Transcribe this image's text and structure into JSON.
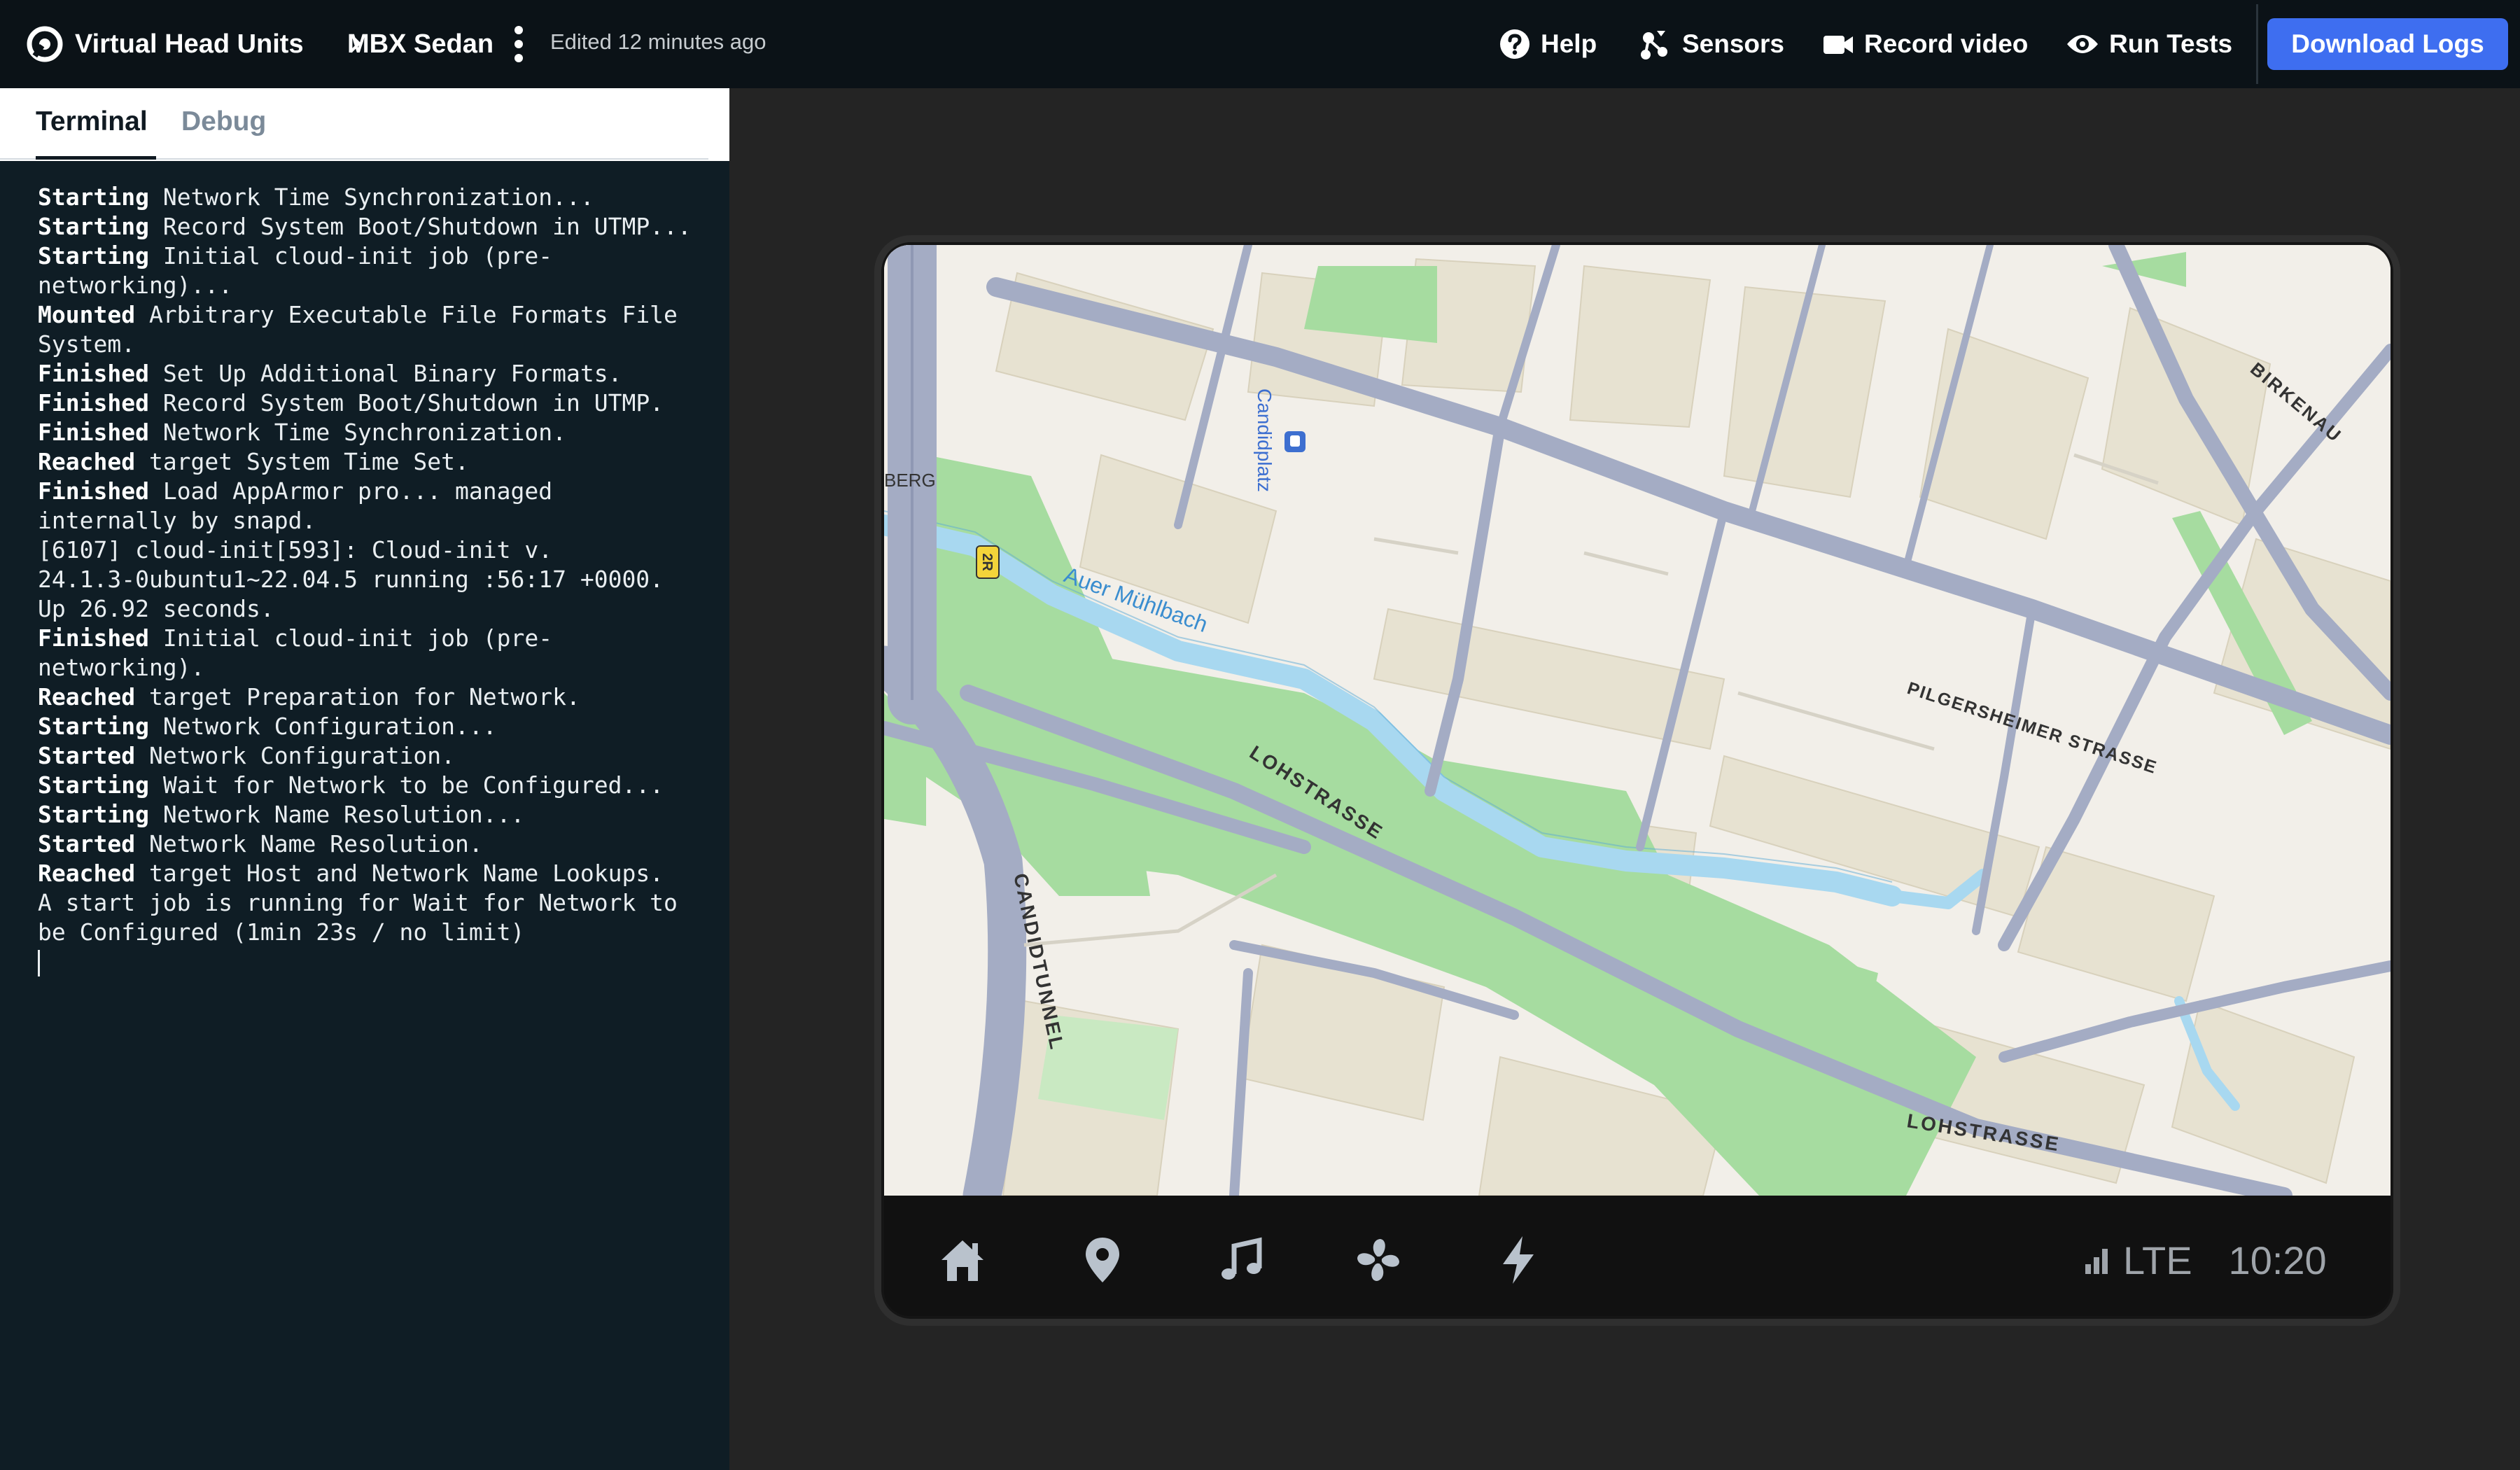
{
  "header": {
    "breadcrumb": [
      "Virtual Head Units",
      "MBX Sedan"
    ],
    "edited_text": "Edited 12 minutes ago",
    "actions": [
      {
        "label": "Help",
        "icon": "help-icon"
      },
      {
        "label": "Sensors",
        "icon": "sensors-icon"
      },
      {
        "label": "Record video",
        "icon": "video-camera-icon"
      },
      {
        "label": "Run Tests",
        "icon": "eye-icon"
      }
    ],
    "download_label": "Download Logs",
    "colors": {
      "topbar": "#0b1217",
      "accent": "#3e6ef0"
    }
  },
  "tabs": [
    {
      "label": "Terminal",
      "active": true
    },
    {
      "label": "Debug",
      "active": false
    }
  ],
  "terminal": {
    "lines": [
      {
        "status": "Starting",
        "text": " Network Time Synchronization..."
      },
      {
        "status": "Starting",
        "text": " Record System Boot/Shutdown in UTMP..."
      },
      {
        "status": "Starting",
        "text": " Initial cloud-init job (pre-"
      },
      {
        "status": "",
        "text": "networking)..."
      },
      {
        "status": "Mounted",
        "text": " Arbitrary Executable File Formats File"
      },
      {
        "status": "",
        "text": "System."
      },
      {
        "status": "Finished",
        "text": " Set Up Additional Binary Formats."
      },
      {
        "status": "Finished",
        "text": " Record System Boot/Shutdown in UTMP."
      },
      {
        "status": "Finished",
        "text": " Network Time Synchronization."
      },
      {
        "status": "Reached",
        "text": " target System Time Set."
      },
      {
        "status": "Finished",
        "text": " Load AppArmor pro... managed"
      },
      {
        "status": "",
        "text": "internally by snapd."
      },
      {
        "status": "",
        "text": "[6107] cloud-init[593]: Cloud-init v."
      },
      {
        "status": "",
        "text": "24.1.3-0ubuntu1~22.04.5 running :56:17 +0000."
      },
      {
        "status": "",
        "text": "Up 26.92 seconds."
      },
      {
        "status": "Finished",
        "text": " Initial cloud-init job (pre-"
      },
      {
        "status": "",
        "text": "networking)."
      },
      {
        "status": "Reached",
        "text": " target Preparation for Network."
      },
      {
        "status": "Starting",
        "text": " Network Configuration..."
      },
      {
        "status": "Started",
        "text": " Network Configuration."
      },
      {
        "status": "Starting",
        "text": " Wait for Network to be Configured..."
      },
      {
        "status": "Starting",
        "text": " Network Name Resolution..."
      },
      {
        "status": "Started",
        "text": " Network Name Resolution."
      },
      {
        "status": "Reached",
        "text": " target Host and Network Name Lookups."
      },
      {
        "status": "",
        "text": "A start job is running for Wait for Network to"
      },
      {
        "status": "",
        "text": "be Configured (1min 23s / no limit)"
      }
    ]
  },
  "map": {
    "labels": {
      "candidplatz": "Candidplatz",
      "berg": "BERG",
      "route": "2R",
      "stream": "Auer Mühlbach",
      "lohstrasse_1": "LOHSTRASSE",
      "lohstrasse_2": "LOHSTRASSE",
      "pilgersheimer": "PILGERSHEIMER STRASSE",
      "birkenau": "BIRKENAU",
      "tunnel": "CANDIDTUNNEL"
    },
    "colors": {
      "land": "#f2efe9",
      "park": "#a6dca0",
      "water": "#a8d8f0",
      "road": "#a4acc4",
      "building": "#e7e2d1"
    }
  },
  "head_unit": {
    "nav_icons": [
      "home-icon",
      "location-pin-icon",
      "music-note-icon",
      "fan-icon",
      "lightning-icon"
    ],
    "network": "LTE",
    "time": "10:20"
  }
}
